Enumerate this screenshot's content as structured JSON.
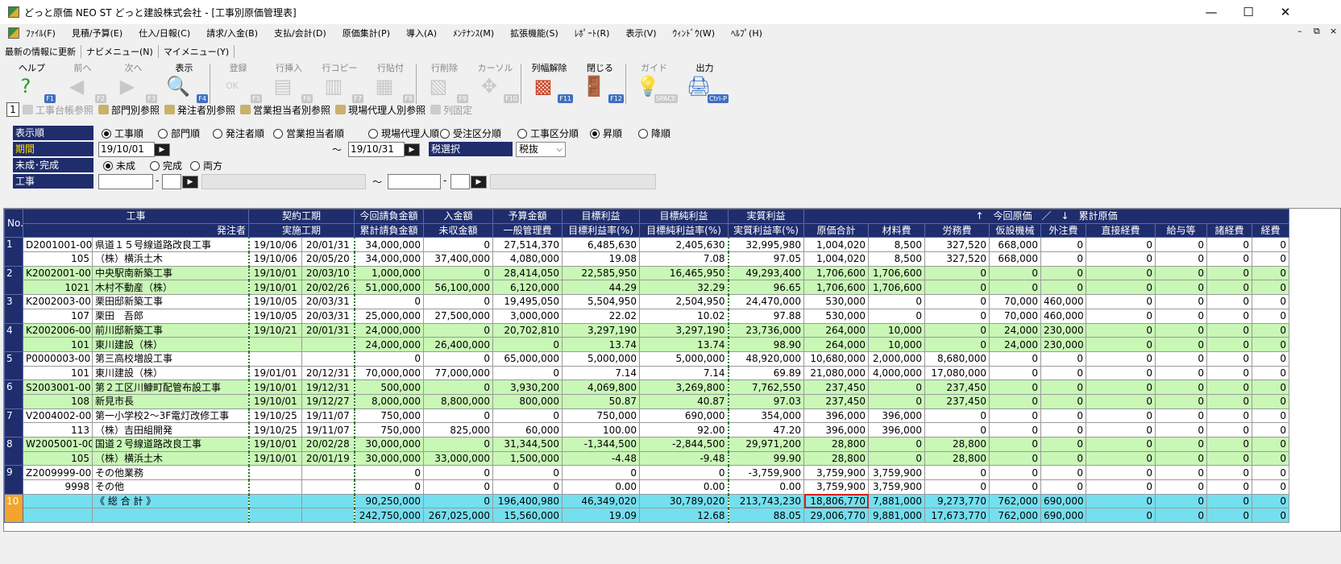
{
  "window": {
    "title": "どっと原価 NEO ST どっと建設株式会社 - [工事別原価管理表]",
    "minimize": "—",
    "maximize": "☐",
    "close": "✕"
  },
  "menu": [
    "ﾌｧｲﾙ(F)",
    "見積/予算(E)",
    "仕入/日報(C)",
    "請求/入金(B)",
    "支払/会計(D)",
    "原価集計(P)",
    "導入(A)",
    "ﾒﾝﾃﾅﾝｽ(M)",
    "拡張機能(S)",
    "ﾚﾎﾟｰﾄ(R)",
    "表示(V)",
    "ｳｨﾝﾄﾞｳ(W)",
    "ﾍﾙﾌﾟ(H)"
  ],
  "mdi": {
    "minimize": "–",
    "restore": "⧉",
    "close": "×"
  },
  "subbar": [
    "最新の情報に更新",
    "ナビメニュー(N)",
    "マイメニュー(Y)"
  ],
  "toolbar": [
    {
      "label": "ヘルプ",
      "key": "F1",
      "icon": "help-icon",
      "glyph": "?"
    },
    {
      "label": "前へ",
      "key": "F2",
      "icon": "arrow-left-icon",
      "glyph": "◀"
    },
    {
      "label": "次へ",
      "key": "F3",
      "icon": "arrow-right-icon",
      "glyph": "▶"
    },
    {
      "label": "表示",
      "key": "F4",
      "icon": "magnifier-icon",
      "glyph": "🔍"
    },
    {
      "label": "登録",
      "key": "F5",
      "icon": "ok-icon",
      "glyph": "OK"
    },
    {
      "label": "行挿入",
      "key": "F6",
      "icon": "insert-row-icon",
      "glyph": "▤"
    },
    {
      "label": "行コピー",
      "key": "F7",
      "icon": "copy-row-icon",
      "glyph": "▥"
    },
    {
      "label": "行貼付",
      "key": "F8",
      "icon": "paste-row-icon",
      "glyph": "▦"
    },
    {
      "label": "行削除",
      "key": "F9",
      "icon": "delete-row-icon",
      "glyph": "▧"
    },
    {
      "label": "カーソル",
      "key": "F10",
      "icon": "cursor-icon",
      "glyph": "✥"
    },
    {
      "label": "列幅解除",
      "key": "F11",
      "icon": "column-width-icon",
      "glyph": "▩"
    },
    {
      "label": "閉じる",
      "key": "F12",
      "icon": "door-icon",
      "glyph": "🚪"
    },
    {
      "label": "ガイド",
      "key": "SPACE",
      "icon": "lightbulb-icon",
      "glyph": "💡"
    },
    {
      "label": "出力",
      "key": "Ctrl-P",
      "icon": "printer-icon",
      "glyph": "🖨"
    }
  ],
  "tabs": {
    "number": "1",
    "items": [
      "工事台帳参照",
      "部門別参照",
      "発注者別参照",
      "営業担当者別参照",
      "現場代理人別参照",
      "列固定"
    ]
  },
  "filters": {
    "order_label": "表示順",
    "order_options": [
      "工事順",
      "部門順",
      "発注者順",
      "営業担当者順",
      "現場代理人順",
      "受注区分順",
      "工事区分順"
    ],
    "sort_options": [
      "昇順",
      "降順"
    ],
    "period_label": "期間",
    "period_from": "19/10/01",
    "period_tilde": "～",
    "period_to": "19/10/31",
    "tax_label": "税選択",
    "tax_value": "税抜",
    "status_label": "未成･完成",
    "status_options": [
      "未成",
      "完成",
      "両方"
    ],
    "project_label": "工事",
    "project_tilde": "～",
    "project_dash": "-"
  },
  "grid": {
    "header1": [
      "No.",
      "工事",
      "契約工期",
      "今回請負金額",
      "入金額",
      "予算金額",
      "目標利益",
      "目標純利益",
      "実質利益",
      "↑　今回原価　／　↓　累計原価"
    ],
    "header2": [
      "発注者",
      "実施工期",
      "累計請負金額",
      "未収金額",
      "一般管理費",
      "目標利益率(%)",
      "目標純利益率(%)",
      "実質利益率(%)",
      "原価合計",
      "材料費",
      "労務費",
      "仮設機械",
      "外注費",
      "直接経費",
      "給与等",
      "諸経費",
      "経費"
    ],
    "rows": [
      {
        "no": "1",
        "a": [
          "D2001001-00",
          "県道１５号線道路改良工事",
          "19/10/06",
          "20/01/31",
          "34,000,000",
          "0",
          "27,514,370",
          "6,485,630",
          "2,405,630",
          "32,995,980",
          "1,004,020",
          "8,500",
          "327,520",
          "668,000",
          "0",
          "0",
          "0",
          "0",
          "0"
        ],
        "b": [
          "105",
          "（株）横浜土木",
          "19/10/06",
          "20/05/20",
          "34,000,000",
          "37,400,000",
          "4,080,000",
          "19.08",
          "7.08",
          "97.05",
          "1,004,020",
          "8,500",
          "327,520",
          "668,000",
          "0",
          "0",
          "0",
          "0",
          "0"
        ]
      },
      {
        "no": "2",
        "a": [
          "K2002001-00",
          "中央駅南新築工事",
          "19/10/01",
          "20/03/10",
          "1,000,000",
          "0",
          "28,414,050",
          "22,585,950",
          "16,465,950",
          "49,293,400",
          "1,706,600",
          "1,706,600",
          "0",
          "0",
          "0",
          "0",
          "0",
          "0",
          "0"
        ],
        "b": [
          "1021",
          "木村不動産（株）",
          "19/10/01",
          "20/02/26",
          "51,000,000",
          "56,100,000",
          "6,120,000",
          "44.29",
          "32.29",
          "96.65",
          "1,706,600",
          "1,706,600",
          "0",
          "0",
          "0",
          "0",
          "0",
          "0",
          "0"
        ]
      },
      {
        "no": "3",
        "a": [
          "K2002003-00",
          "栗田邸新築工事",
          "19/10/05",
          "20/03/31",
          "0",
          "0",
          "19,495,050",
          "5,504,950",
          "2,504,950",
          "24,470,000",
          "530,000",
          "0",
          "0",
          "70,000",
          "460,000",
          "0",
          "0",
          "0",
          "0"
        ],
        "b": [
          "107",
          "栗田　吾郎",
          "19/10/05",
          "20/03/31",
          "25,000,000",
          "27,500,000",
          "3,000,000",
          "22.02",
          "10.02",
          "97.88",
          "530,000",
          "0",
          "0",
          "70,000",
          "460,000",
          "0",
          "0",
          "0",
          "0"
        ]
      },
      {
        "no": "4",
        "a": [
          "K2002006-00",
          "前川邸新築工事",
          "19/10/21",
          "20/01/31",
          "24,000,000",
          "0",
          "20,702,810",
          "3,297,190",
          "3,297,190",
          "23,736,000",
          "264,000",
          "10,000",
          "0",
          "24,000",
          "230,000",
          "0",
          "0",
          "0",
          "0"
        ],
        "b": [
          "101",
          "東川建設（株）",
          "",
          "",
          "24,000,000",
          "26,400,000",
          "0",
          "13.74",
          "13.74",
          "98.90",
          "264,000",
          "10,000",
          "0",
          "24,000",
          "230,000",
          "0",
          "0",
          "0",
          "0"
        ]
      },
      {
        "no": "5",
        "a": [
          "P0000003-00",
          "第三高校増設工事",
          "",
          "",
          "0",
          "0",
          "65,000,000",
          "5,000,000",
          "5,000,000",
          "48,920,000",
          "10,680,000",
          "2,000,000",
          "8,680,000",
          "0",
          "0",
          "0",
          "0",
          "0",
          "0"
        ],
        "b": [
          "101",
          "東川建設（株）",
          "19/01/01",
          "20/12/31",
          "70,000,000",
          "77,000,000",
          "0",
          "7.14",
          "7.14",
          "69.89",
          "21,080,000",
          "4,000,000",
          "17,080,000",
          "0",
          "0",
          "0",
          "0",
          "0",
          "0"
        ]
      },
      {
        "no": "6",
        "a": [
          "S2003001-00",
          "第２工区川鱇町配管布設工事",
          "19/10/01",
          "19/12/31",
          "500,000",
          "0",
          "3,930,200",
          "4,069,800",
          "3,269,800",
          "7,762,550",
          "237,450",
          "0",
          "237,450",
          "0",
          "0",
          "0",
          "0",
          "0",
          "0"
        ],
        "b": [
          "108",
          "新見市長",
          "19/10/01",
          "19/12/27",
          "8,000,000",
          "8,800,000",
          "800,000",
          "50.87",
          "40.87",
          "97.03",
          "237,450",
          "0",
          "237,450",
          "0",
          "0",
          "0",
          "0",
          "0",
          "0"
        ]
      },
      {
        "no": "7",
        "a": [
          "V2004002-00",
          "第一小学校2～3F電灯改修工事",
          "19/10/25",
          "19/11/07",
          "750,000",
          "0",
          "0",
          "750,000",
          "690,000",
          "354,000",
          "396,000",
          "396,000",
          "0",
          "0",
          "0",
          "0",
          "0",
          "0",
          "0"
        ],
        "b": [
          "113",
          "（株）吉田組開発",
          "19/10/25",
          "19/11/07",
          "750,000",
          "825,000",
          "60,000",
          "100.00",
          "92.00",
          "47.20",
          "396,000",
          "396,000",
          "0",
          "0",
          "0",
          "0",
          "0",
          "0",
          "0"
        ]
      },
      {
        "no": "8",
        "a": [
          "W2005001-00",
          "国道２号線道路改良工事",
          "19/10/01",
          "20/02/28",
          "30,000,000",
          "0",
          "31,344,500",
          "-1,344,500",
          "-2,844,500",
          "29,971,200",
          "28,800",
          "0",
          "28,800",
          "0",
          "0",
          "0",
          "0",
          "0",
          "0"
        ],
        "b": [
          "105",
          "（株）横浜土木",
          "19/10/01",
          "20/01/19",
          "30,000,000",
          "33,000,000",
          "1,500,000",
          "-4.48",
          "-9.48",
          "99.90",
          "28,800",
          "0",
          "28,800",
          "0",
          "0",
          "0",
          "0",
          "0",
          "0"
        ]
      },
      {
        "no": "9",
        "a": [
          "Z2009999-00",
          "その他業務",
          "",
          "",
          "0",
          "0",
          "0",
          "0",
          "0",
          "-3,759,900",
          "3,759,900",
          "3,759,900",
          "0",
          "0",
          "0",
          "0",
          "0",
          "0",
          "0"
        ],
        "b": [
          "9998",
          "その他",
          "",
          "",
          "0",
          "0",
          "0",
          "0.00",
          "0.00",
          "0.00",
          "3,759,900",
          "3,759,900",
          "0",
          "0",
          "0",
          "0",
          "0",
          "0",
          "0"
        ]
      },
      {
        "no": "10",
        "a": [
          "",
          "《 総 合 計 》",
          "",
          "",
          "90,250,000",
          "0",
          "196,400,980",
          "46,349,020",
          "30,789,020",
          "213,743,230",
          "18,806,770",
          "7,881,000",
          "9,273,770",
          "762,000",
          "690,000",
          "0",
          "0",
          "0",
          "0"
        ],
        "b": [
          "",
          "",
          "",
          "",
          "242,750,000",
          "267,025,000",
          "15,560,000",
          "19.09",
          "12.68",
          "88.05",
          "29,006,770",
          "9,881,000",
          "17,673,770",
          "762,000",
          "690,000",
          "0",
          "0",
          "0",
          "0"
        ]
      }
    ]
  },
  "colors": {
    "header_navy": "#1f2d6d",
    "row_green": "#c9f7b6",
    "total_cyan": "#74dfef",
    "total_no_orange": "#f2a52a",
    "highlight_red": "#d52020"
  }
}
